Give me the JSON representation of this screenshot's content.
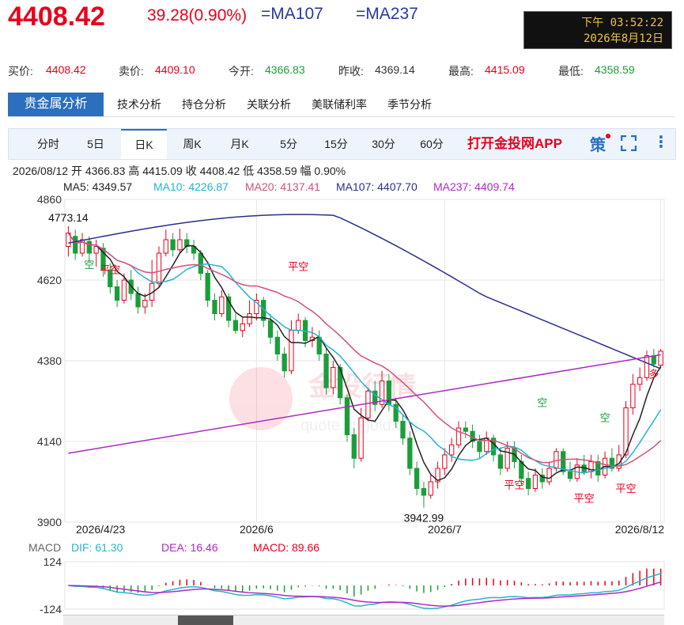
{
  "header": {
    "price": "4408.42",
    "change": "39.28(0.90%)",
    "ma107": "=MA107",
    "ma237": "=MA237",
    "clock_time": "下午 03:52:22",
    "clock_date": "2026年8月12日"
  },
  "quote": {
    "bid_label": "买价:",
    "bid": "4408.42",
    "ask_label": "卖价:",
    "ask": "4409.10",
    "open_label": "今开:",
    "open": "4366.83",
    "prev_label": "昨收:",
    "prev": "4369.14",
    "high_label": "最高:",
    "high": "4415.09",
    "low_label": "最低:",
    "low": "4358.59"
  },
  "tabs_primary": [
    "贵金属分析",
    "技术分析",
    "持仓分析",
    "关联分析",
    "美联储利率",
    "季节分析"
  ],
  "tabs_period": [
    "分时",
    "5日",
    "日K",
    "周K",
    "月K",
    "5分",
    "15分",
    "30分",
    "60分"
  ],
  "promo": "打开金投网APP",
  "info_line": "2026/08/12  开 4366.83  高 4415.09  收 4408.42  低 4358.59  幅 0.90%",
  "ma_legend": [
    {
      "label": "MA5: 4349.57",
      "color": "#222222"
    },
    {
      "label": "MA10: 4226.87",
      "color": "#26b3cf"
    },
    {
      "label": "MA20: 4137.41",
      "color": "#d44f7e"
    },
    {
      "label": "MA107: 4407.70",
      "color": "#2a2f8e"
    },
    {
      "label": "MA237: 4409.74",
      "color": "#b027c8"
    }
  ],
  "macd_legend": {
    "title": "MACD",
    "dif": "DIF: 61.30",
    "dea": "DEA: 16.46",
    "macd": "MACD: 89.66"
  },
  "colors": {
    "up": "#e8001c",
    "down": "#1a9e3a",
    "ma5": "#222222",
    "ma10": "#26b3cf",
    "ma20": "#d44f7e",
    "ma107": "#2a2f8e",
    "ma237": "#b027c8"
  },
  "chart_data": {
    "type": "candlestick",
    "y_ticks": [
      4860,
      4620,
      4380,
      4140,
      3900
    ],
    "ylim": [
      3900,
      4860
    ],
    "x_tick_labels": [
      "2026/4/23",
      "2026/6",
      "2026/7",
      "2026/8/12"
    ],
    "annotations": [
      "4773.14",
      "3942.99"
    ],
    "signal_labels": [
      "空",
      "平空",
      "平空",
      "空",
      "平空",
      "空",
      "平空",
      "平空",
      "多"
    ],
    "candles": [
      [
        4720,
        4760,
        4780,
        4690
      ],
      [
        4750,
        4700,
        4770,
        4680
      ],
      [
        4700,
        4740,
        4760,
        4690
      ],
      [
        4735,
        4700,
        4750,
        4670
      ],
      [
        4700,
        4720,
        4740,
        4660
      ],
      [
        4715,
        4650,
        4730,
        4630
      ],
      [
        4650,
        4600,
        4670,
        4580
      ],
      [
        4600,
        4560,
        4620,
        4540
      ],
      [
        4560,
        4620,
        4640,
        4550
      ],
      [
        4620,
        4580,
        4650,
        4560
      ],
      [
        4580,
        4540,
        4600,
        4520
      ],
      [
        4540,
        4560,
        4580,
        4520
      ],
      [
        4560,
        4610,
        4680,
        4540
      ],
      [
        4610,
        4700,
        4720,
        4600
      ],
      [
        4700,
        4740,
        4770,
        4690
      ],
      [
        4740,
        4710,
        4760,
        4690
      ],
      [
        4710,
        4740,
        4773,
        4700
      ],
      [
        4740,
        4720,
        4760,
        4700
      ],
      [
        4720,
        4700,
        4740,
        4680
      ],
      [
        4700,
        4640,
        4710,
        4620
      ],
      [
        4640,
        4560,
        4650,
        4540
      ],
      [
        4560,
        4520,
        4580,
        4500
      ],
      [
        4520,
        4570,
        4590,
        4510
      ],
      [
        4570,
        4500,
        4580,
        4480
      ],
      [
        4500,
        4470,
        4520,
        4460
      ],
      [
        4470,
        4490,
        4510,
        4450
      ],
      [
        4490,
        4520,
        4560,
        4480
      ],
      [
        4520,
        4560,
        4580,
        4500
      ],
      [
        4560,
        4500,
        4570,
        4480
      ],
      [
        4500,
        4450,
        4520,
        4430
      ],
      [
        4450,
        4400,
        4470,
        4380
      ],
      [
        4400,
        4350,
        4420,
        4330
      ],
      [
        4350,
        4470,
        4500,
        4340
      ],
      [
        4470,
        4500,
        4520,
        4460
      ],
      [
        4500,
        4440,
        4510,
        4420
      ],
      [
        4440,
        4450,
        4480,
        4420
      ],
      [
        4450,
        4400,
        4470,
        4380
      ],
      [
        4400,
        4300,
        4420,
        4280
      ],
      [
        4300,
        4360,
        4380,
        4280
      ],
      [
        4360,
        4270,
        4370,
        4250
      ],
      [
        4270,
        4160,
        4280,
        4140
      ],
      [
        4160,
        4090,
        4180,
        4060
      ],
      [
        4090,
        4210,
        4240,
        4080
      ],
      [
        4210,
        4290,
        4300,
        4200
      ],
      [
        4290,
        4250,
        4320,
        4230
      ],
      [
        4250,
        4320,
        4350,
        4240
      ],
      [
        4320,
        4250,
        4340,
        4230
      ],
      [
        4250,
        4200,
        4270,
        4180
      ],
      [
        4200,
        4150,
        4220,
        4130
      ],
      [
        4150,
        4060,
        4170,
        4040
      ],
      [
        4060,
        4000,
        4080,
        3980
      ],
      [
        4000,
        3980,
        4020,
        3942.99
      ],
      [
        3980,
        4020,
        4040,
        3970
      ],
      [
        4020,
        4060,
        4080,
        4000
      ],
      [
        4060,
        4100,
        4120,
        4040
      ],
      [
        4100,
        4130,
        4150,
        4080
      ],
      [
        4130,
        4180,
        4200,
        4120
      ],
      [
        4180,
        4170,
        4200,
        4150
      ],
      [
        4170,
        4140,
        4190,
        4120
      ],
      [
        4140,
        4110,
        4160,
        4090
      ],
      [
        4110,
        4150,
        4170,
        4100
      ],
      [
        4150,
        4100,
        4160,
        4080
      ],
      [
        4100,
        4060,
        4120,
        4040
      ],
      [
        4060,
        4120,
        4140,
        4050
      ],
      [
        4120,
        4080,
        4140,
        4060
      ],
      [
        4080,
        4030,
        4100,
        4010
      ],
      [
        4030,
        4000,
        4050,
        3980
      ],
      [
        4000,
        4040,
        4060,
        3990
      ],
      [
        4040,
        4020,
        4060,
        4000
      ],
      [
        4020,
        4060,
        4080,
        4010
      ],
      [
        4060,
        4110,
        4120,
        4050
      ],
      [
        4110,
        4050,
        4120,
        4040
      ],
      [
        4050,
        4030,
        4080,
        4020
      ],
      [
        4030,
        4070,
        4090,
        4020
      ],
      [
        4070,
        4050,
        4100,
        4040
      ],
      [
        4050,
        4080,
        4100,
        4030
      ],
      [
        4080,
        4040,
        4100,
        4020
      ],
      [
        4040,
        4090,
        4110,
        4030
      ],
      [
        4090,
        4060,
        4120,
        4050
      ],
      [
        4060,
        4100,
        4130,
        4050
      ],
      [
        4100,
        4240,
        4260,
        4090
      ],
      [
        4240,
        4310,
        4340,
        4220
      ],
      [
        4310,
        4330,
        4360,
        4290
      ],
      [
        4330,
        4395,
        4410,
        4320
      ],
      [
        4395,
        4370,
        4415,
        4360
      ],
      [
        4366.83,
        4408.42,
        4415.09,
        4358.59
      ]
    ],
    "macd_ylim": [
      -124,
      124
    ]
  }
}
